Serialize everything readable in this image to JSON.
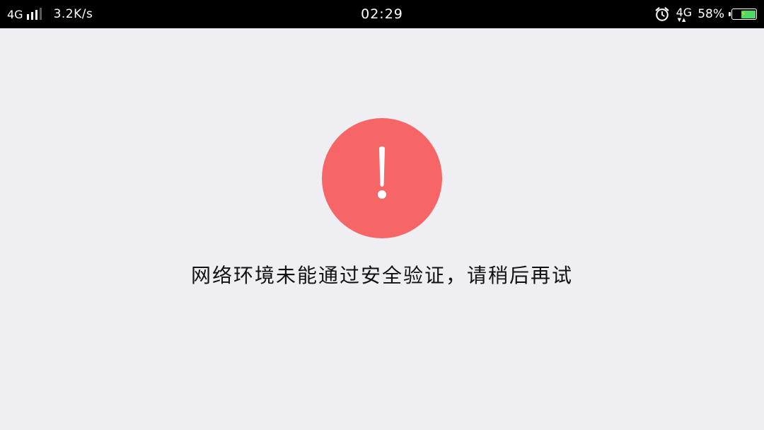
{
  "status_bar": {
    "network_type": "4G",
    "net_speed": "3.2K/s",
    "time": "02:29",
    "network_type_right": "4G",
    "battery_percent": "58%",
    "battery_level": 0.58
  },
  "error_page": {
    "icon": "exclamation-circle-icon",
    "icon_color": "#f66666",
    "message": "网络环境未能通过安全验证，请稍后再试"
  },
  "colors": {
    "status_bar_bg": "#000000",
    "page_bg": "#efeef3",
    "battery_fill": "#4cd964"
  }
}
